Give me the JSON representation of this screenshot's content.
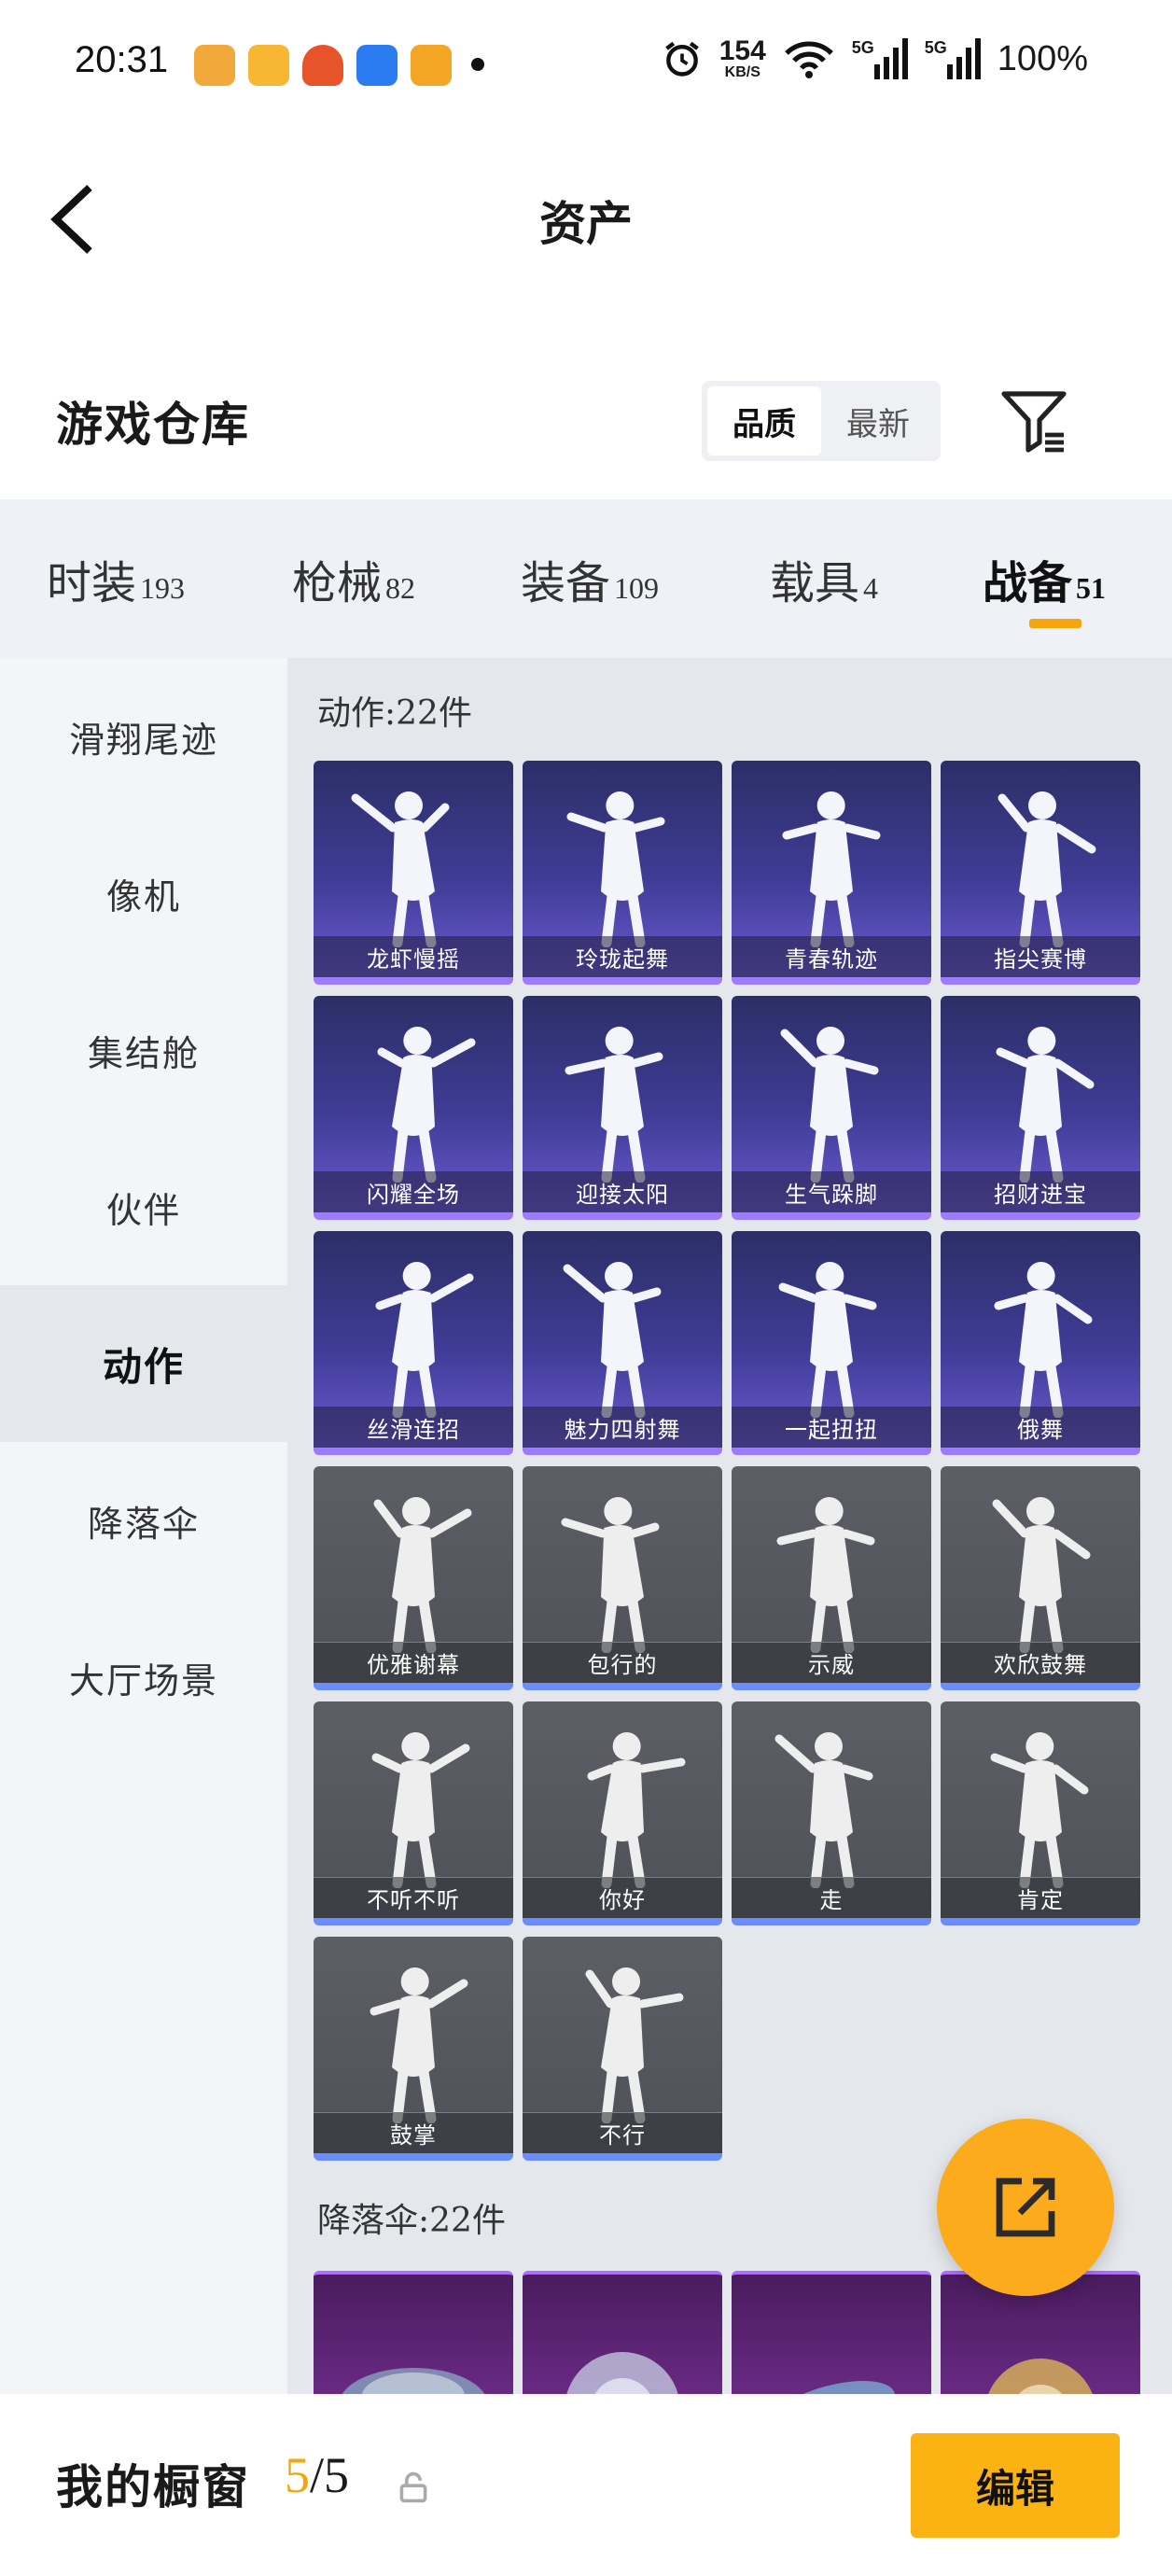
{
  "status_bar": {
    "time": "20:31",
    "speed_value": "154",
    "speed_unit": "KB/S",
    "signal_1": "5G",
    "signal_2": "5G",
    "battery": "100%",
    "app_colors": [
      "#f2a93b",
      "#f7b733",
      "#e8542a",
      "#2a7cf0",
      "#f3a623"
    ]
  },
  "header": {
    "title": "资产",
    "back_icon": "chevron-left-icon"
  },
  "warehouse": {
    "title": "游戏仓库",
    "sort_options": [
      "品质",
      "最新"
    ],
    "sort_active": "品质",
    "filter_icon": "filter-icon"
  },
  "tabs": [
    {
      "label": "时装",
      "count": "193"
    },
    {
      "label": "枪械",
      "count": "82"
    },
    {
      "label": "装备",
      "count": "109"
    },
    {
      "label": "载具",
      "count": "4"
    },
    {
      "label": "战备",
      "count": "51",
      "active": true
    }
  ],
  "sidebar": {
    "items": [
      "滑翔尾迹",
      "像机",
      "集结舱",
      "伙伴",
      "动作",
      "降落伞",
      "大厅场景"
    ],
    "active": "动作"
  },
  "sections": {
    "actions_title": "动作:22件",
    "parachute_title": "降落伞:22件"
  },
  "action_cards": [
    {
      "label": "龙虾慢摇",
      "tier": "purple"
    },
    {
      "label": "玲珑起舞",
      "tier": "purple"
    },
    {
      "label": "青春轨迹",
      "tier": "purple"
    },
    {
      "label": "指尖赛博",
      "tier": "purple"
    },
    {
      "label": "闪耀全场",
      "tier": "purple"
    },
    {
      "label": "迎接太阳",
      "tier": "purple"
    },
    {
      "label": "生气跺脚",
      "tier": "purple"
    },
    {
      "label": "招财进宝",
      "tier": "purple"
    },
    {
      "label": "丝滑连招",
      "tier": "purple"
    },
    {
      "label": "魅力四射舞",
      "tier": "purple"
    },
    {
      "label": "一起扭扭",
      "tier": "purple"
    },
    {
      "label": "俄舞",
      "tier": "purple"
    },
    {
      "label": "优雅谢幕",
      "tier": "gray"
    },
    {
      "label": "包行的",
      "tier": "gray"
    },
    {
      "label": "示威",
      "tier": "gray"
    },
    {
      "label": "欢欣鼓舞",
      "tier": "gray"
    },
    {
      "label": "不听不听",
      "tier": "gray"
    },
    {
      "label": "你好",
      "tier": "gray"
    },
    {
      "label": "走",
      "tier": "gray"
    },
    {
      "label": "肯定",
      "tier": "gray"
    },
    {
      "label": "鼓掌",
      "tier": "gray"
    },
    {
      "label": "不行",
      "tier": "gray"
    }
  ],
  "bottom_bar": {
    "title": "我的橱窗",
    "count_current": "5",
    "count_sep": "/5",
    "edit_label": "编辑",
    "accent": "#f5a60a"
  }
}
